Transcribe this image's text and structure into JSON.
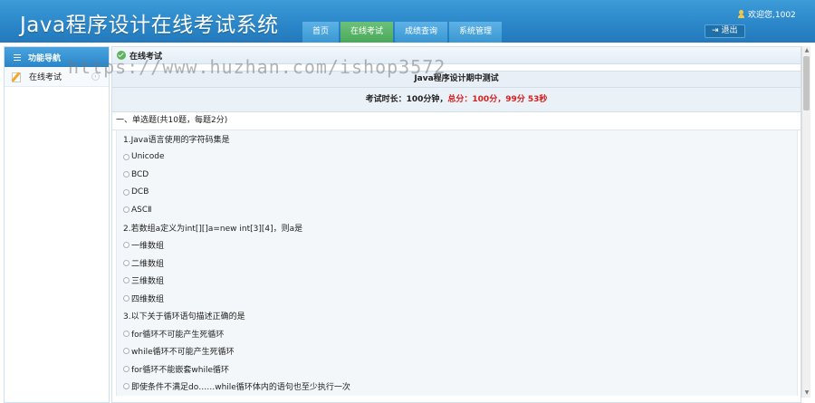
{
  "header": {
    "app_title": "Java程序设计在线考试系统",
    "nav": [
      {
        "label": "首页",
        "active": false
      },
      {
        "label": "在线考试",
        "active": true
      },
      {
        "label": "成绩查询",
        "active": false
      },
      {
        "label": "系统管理",
        "active": false
      }
    ],
    "welcome": "欢迎您,1002",
    "logout_label": "退出",
    "colors": {
      "header_bg": "#2a86c8",
      "active_tab": "#4aa95a"
    }
  },
  "sidebar": {
    "title": "功能导航",
    "items": [
      {
        "label": "在线考试",
        "icon": "pencil-icon"
      }
    ]
  },
  "main": {
    "panel_title": "在线考试",
    "exam_title": "Java程序设计期中测试",
    "info": {
      "duration": "考试时长：100分钟，",
      "total": "总分：100分，",
      "remaining": "99分 53秒"
    },
    "section_title": "一、单选题(共10题，每题2分)",
    "questions": [
      {
        "text": "1.Java语言使用的字符码集是",
        "options": [
          "Unicode",
          "BCD",
          "DCB",
          "ASCⅡ"
        ]
      },
      {
        "text": "2.若数组a定义为int[][]a=new int[3][4]，则a是",
        "options": [
          "一维数组",
          "二维数组",
          "三维数组",
          "四维数组"
        ]
      },
      {
        "text": "3.以下关于循环语句描述正确的是",
        "options": [
          "for循环不可能产生死循环",
          "while循环不可能产生死循环",
          "for循环不能嵌套while循环",
          "即使条件不满足do……while循环体内的语句也至少执行一次"
        ]
      }
    ]
  },
  "watermark": "https://www.huzhan.com/ishop3572"
}
